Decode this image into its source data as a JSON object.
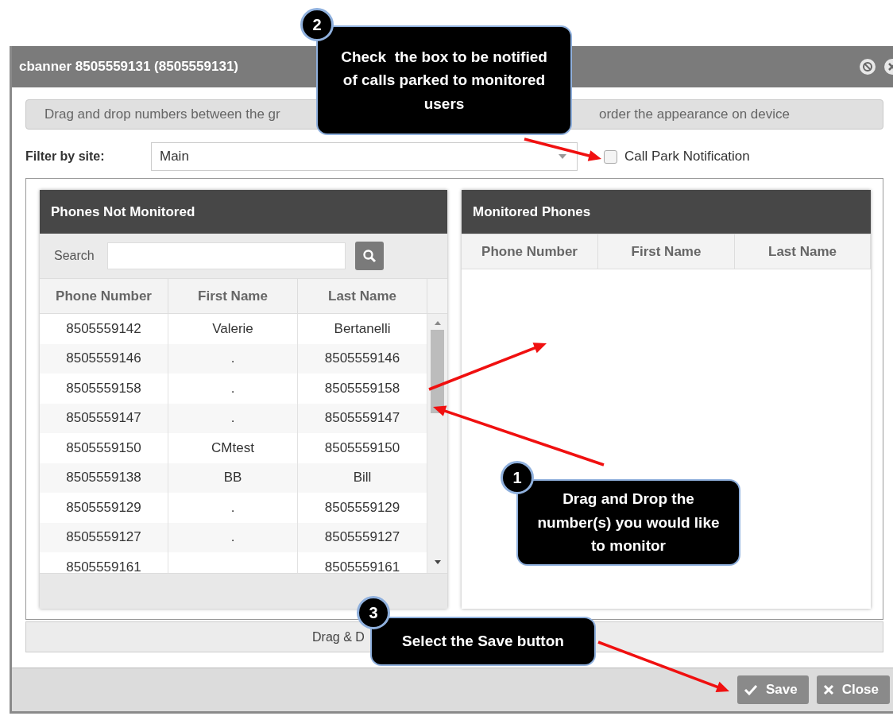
{
  "dialog": {
    "title": "cbanner 8505559131 (8505559131)",
    "instructions": [
      "Drag and drop numbers between the gr",
      "order the appearance on device"
    ],
    "filter": {
      "label": "Filter by site:",
      "value": "Main"
    },
    "call_park_notification": {
      "label": "Call Park Notification",
      "checked": false
    },
    "left_panel": {
      "title": "Phones Not Monitored",
      "search_label": "Search",
      "columns": [
        "Phone Number",
        "First Name",
        "Last Name"
      ],
      "rows": [
        {
          "phone": "8505559142",
          "first_name": "Valerie",
          "last_name": "Bertanelli"
        },
        {
          "phone": "8505559146",
          "first_name": ".",
          "last_name": "8505559146"
        },
        {
          "phone": "8505559158",
          "first_name": ".",
          "last_name": "8505559158"
        },
        {
          "phone": "8505559147",
          "first_name": ".",
          "last_name": "8505559147"
        },
        {
          "phone": "8505559150",
          "first_name": "CMtest",
          "last_name": "8505559150"
        },
        {
          "phone": "8505559138",
          "first_name": "BB",
          "last_name": "Bill"
        },
        {
          "phone": "8505559129",
          "first_name": ".",
          "last_name": "8505559129"
        },
        {
          "phone": "8505559127",
          "first_name": ".",
          "last_name": "8505559127"
        },
        {
          "phone": "8505559161",
          "last_name": "8505559161"
        }
      ]
    },
    "right_panel": {
      "title": "Monitored Phones",
      "columns": [
        "Phone Number",
        "First Name",
        "Last Name"
      ]
    },
    "footer_hint": "Drag & D",
    "buttons": [
      {
        "label": "Save",
        "kind": "save"
      },
      {
        "label": "Close",
        "kind": "close"
      }
    ]
  },
  "callouts": [
    {
      "number": "2",
      "text": "Check  the box to be notified  of calls parked to monitored users"
    },
    {
      "number": "1",
      "text": "Drag and Drop the number(s) you would like  to monitor"
    },
    {
      "number": "3",
      "text": "Select the Save button"
    }
  ]
}
